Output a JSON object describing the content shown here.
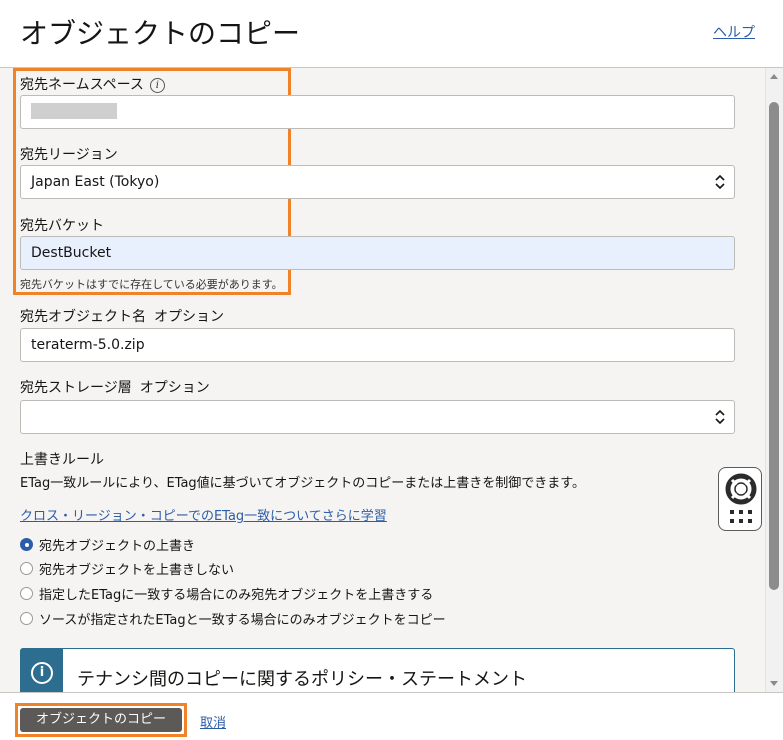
{
  "header": {
    "title": "オブジェクトのコピー",
    "help_label": "ヘルプ"
  },
  "form": {
    "dest_namespace": {
      "label": "宛先ネームスペース",
      "info_glyph": "i",
      "value": ""
    },
    "dest_region": {
      "label": "宛先リージョン",
      "value": "Japan East (Tokyo)"
    },
    "dest_bucket": {
      "label": "宛先バケット",
      "value": "DestBucket",
      "hint": "宛先バケットはすでに存在している必要があります。"
    },
    "dest_object_name": {
      "label": "宛先オブジェクト名",
      "optional": "オプション",
      "value": "teraterm-5.0.zip"
    },
    "dest_storage_tier": {
      "label": "宛先ストレージ層",
      "optional": "オプション",
      "value": ""
    },
    "overwrite_rule": {
      "heading": "上書きルール",
      "description": "ETag一致ルールにより、ETag値に基づいてオブジェクトのコピーまたは上書きを制御できます。",
      "learn_link": "クロス・リージョン・コピーでのETag一致についてさらに学習",
      "options": [
        "宛先オブジェクトの上書き",
        "宛先オブジェクトを上書きしない",
        "指定したETagに一致する場合にのみ宛先オブジェクトを上書きする",
        "ソースが指定されたETagと一致する場合にのみオブジェクトをコピー"
      ],
      "selected_index": 0
    },
    "policy_notice": {
      "icon_glyph": "i",
      "text": "テナンシ間のコピーに関するポリシー・ステートメント"
    }
  },
  "footer": {
    "copy_button_label": "オブジェクトのコピー",
    "cancel_label": "取消"
  },
  "icons": {
    "info": "info-icon",
    "select_chevron": "chevron-up-down-icon",
    "help_widget": "lifebuoy-icon",
    "grid": "grid-dots-icon"
  },
  "colors": {
    "accent_link": "#2c5da7",
    "highlight": "#f08227",
    "primary_button": "#5c5956",
    "notice": "#2c6d90"
  }
}
